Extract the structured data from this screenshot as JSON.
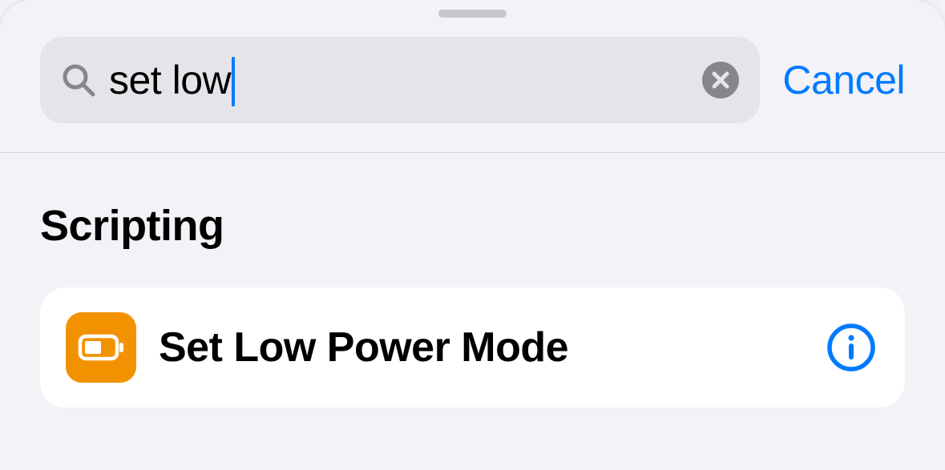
{
  "search": {
    "value": "set low",
    "cancel_label": "Cancel"
  },
  "sections": [
    {
      "title": "Scripting",
      "items": [
        {
          "title": "Set Low Power Mode"
        }
      ]
    }
  ],
  "colors": {
    "tint": "#007aff",
    "action_icon_bg": "#f39200"
  }
}
